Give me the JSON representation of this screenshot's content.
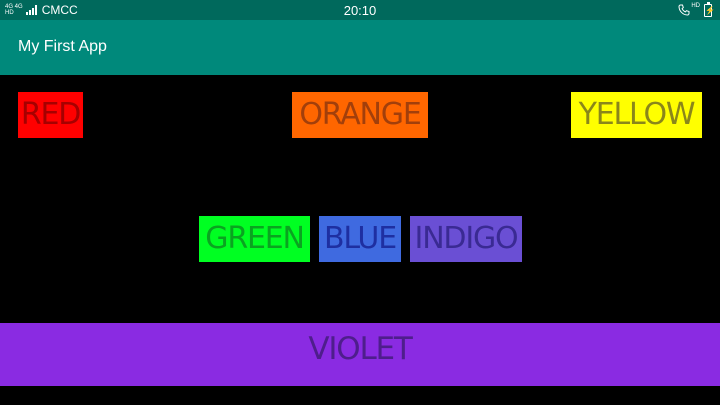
{
  "status_bar": {
    "network_type_top": "4G 4G",
    "network_type_bottom": "HD",
    "carrier": "CMCC",
    "time": "20:10",
    "call_hd_label": "HD",
    "phone_icon": "phone-hd-icon",
    "battery_icon": "battery-charging-icon"
  },
  "action_bar": {
    "title": "My First App",
    "color": "#00897b"
  },
  "boxes": {
    "red": {
      "label": "RED",
      "background": "#ff0000"
    },
    "orange": {
      "label": "ORANGE",
      "background": "#ff6600"
    },
    "yellow": {
      "label": "YELLOW",
      "background": "#ffff00"
    },
    "green": {
      "label": "GREEN",
      "background": "#00ff22"
    },
    "blue": {
      "label": "BLUE",
      "background": "#3f6ae0"
    },
    "indigo": {
      "label": "INDIGO",
      "background": "#6a4fd4"
    },
    "violet": {
      "label": "VIOLET",
      "background": "#8a2be2"
    }
  },
  "theme": {
    "status_bar_color": "#00695c",
    "background": "#000000"
  }
}
